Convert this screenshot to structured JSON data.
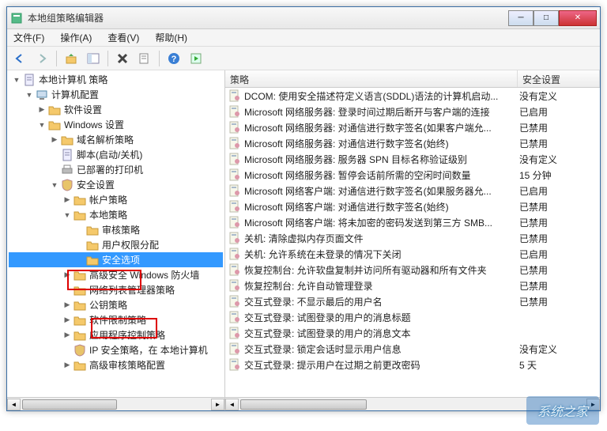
{
  "window": {
    "title": "本地组策略编辑器"
  },
  "menu": {
    "file": "文件(F)",
    "action": "操作(A)",
    "view": "查看(V)",
    "help": "帮助(H)"
  },
  "tree": {
    "root": "本地计算机 策略",
    "computer_config": "计算机配置",
    "software_settings": "软件设置",
    "windows_settings": "Windows 设置",
    "name_resolution": "域名解析策略",
    "scripts": "脚本(启动/关机)",
    "printers": "已部署的打印机",
    "security_settings": "安全设置",
    "account_policy": "帐户策略",
    "local_policy": "本地策略",
    "audit_policy": "审核策略",
    "user_rights": "用户权限分配",
    "security_options": "安全选项",
    "adv_firewall": "高级安全 Windows 防火墙",
    "nlm_policy": "网络列表管理器策略",
    "public_key": "公钥策略",
    "software_restriction": "软件限制策略",
    "app_control": "应用程序控制策略",
    "ip_security": "IP 安全策略，在 本地计算机",
    "adv_audit": "高级审核策略配置"
  },
  "list": {
    "col_policy": "策略",
    "col_setting": "安全设置",
    "rows": [
      {
        "policy": "DCOM: 使用安全描述符定义语言(SDDL)语法的计算机启动...",
        "setting": "没有定义"
      },
      {
        "policy": "Microsoft 网络服务器: 登录时间过期后断开与客户端的连接",
        "setting": "已启用"
      },
      {
        "policy": "Microsoft 网络服务器: 对通信进行数字签名(如果客户端允...",
        "setting": "已禁用"
      },
      {
        "policy": "Microsoft 网络服务器: 对通信进行数字签名(始终)",
        "setting": "已禁用"
      },
      {
        "policy": "Microsoft 网络服务器: 服务器 SPN 目标名称验证级别",
        "setting": "没有定义"
      },
      {
        "policy": "Microsoft 网络服务器: 暂停会话前所需的空闲时间数量",
        "setting": "15 分钟"
      },
      {
        "policy": "Microsoft 网络客户端: 对通信进行数字签名(如果服务器允...",
        "setting": "已启用"
      },
      {
        "policy": "Microsoft 网络客户端: 对通信进行数字签名(始终)",
        "setting": "已禁用"
      },
      {
        "policy": "Microsoft 网络客户端: 将未加密的密码发送到第三方 SMB...",
        "setting": "已禁用"
      },
      {
        "policy": "关机: 清除虚拟内存页面文件",
        "setting": "已禁用"
      },
      {
        "policy": "关机: 允许系统在未登录的情况下关闭",
        "setting": "已启用"
      },
      {
        "policy": "恢复控制台: 允许软盘复制并访问所有驱动器和所有文件夹",
        "setting": "已禁用"
      },
      {
        "policy": "恢复控制台: 允许自动管理登录",
        "setting": "已禁用"
      },
      {
        "policy": "交互式登录: 不显示最后的用户名",
        "setting": "已禁用"
      },
      {
        "policy": "交互式登录: 试图登录的用户的消息标题",
        "setting": ""
      },
      {
        "policy": "交互式登录: 试图登录的用户的消息文本",
        "setting": ""
      },
      {
        "policy": "交互式登录: 锁定会话时显示用户信息",
        "setting": "没有定义"
      },
      {
        "policy": "交互式登录: 提示用户在过期之前更改密码",
        "setting": "5 天"
      }
    ]
  },
  "watermark": "系统之家"
}
